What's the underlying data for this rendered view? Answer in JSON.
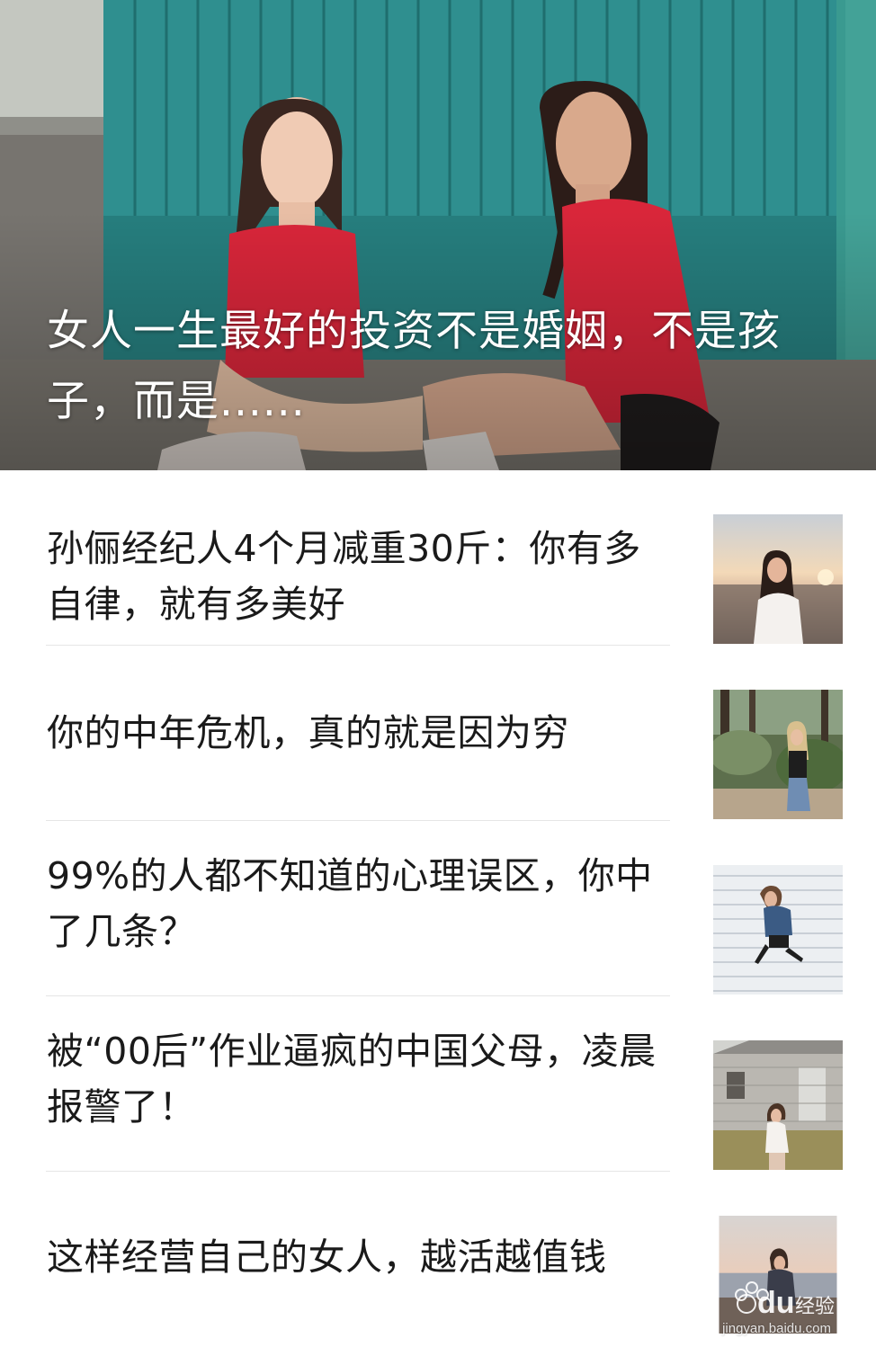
{
  "hero": {
    "title": "女人一生最好的投资不是婚姻，不是孩子，而是......",
    "image_icon": "two-women-sitting-photo"
  },
  "articles": [
    {
      "title": "孙俪经纪人4个月减重30斤：你有多自律，就有多美好",
      "thumb_icon": "woman-on-beach-sunset-photo"
    },
    {
      "title": "你的中年危机，真的就是因为穷",
      "thumb_icon": "woman-in-forest-photo"
    },
    {
      "title": "99%的人都不知道的心理误区，你中了几条？",
      "thumb_icon": "woman-jumping-photo"
    },
    {
      "title": "被“00后”作业逼疯的中国父母，凌晨报警了！",
      "thumb_icon": "woman-by-old-house-photo"
    },
    {
      "title": "这样经营自己的女人，越活越值钱",
      "thumb_icon": "woman-by-lake-photo"
    }
  ],
  "watermark": {
    "logo": "Bai du 经验",
    "url": "jingyan.baidu.com"
  },
  "colors": {
    "wall_teal": "#2f8f8f",
    "jersey_red": "#d9263a",
    "text_dark": "#1a1a1a",
    "divider": "#e6e6e6"
  }
}
